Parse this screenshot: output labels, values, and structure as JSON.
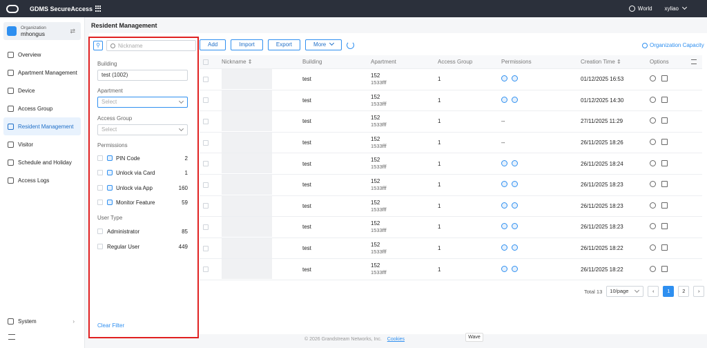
{
  "app": {
    "title": "GDMS SecureAccess"
  },
  "topbar": {
    "region": "World",
    "user": "xyliao"
  },
  "sidebar": {
    "org_label": "Organization",
    "org_name": "mhongus",
    "items": [
      {
        "label": "Overview",
        "icon": "overview-icon"
      },
      {
        "label": "Apartment Management",
        "icon": "building-icon"
      },
      {
        "label": "Device",
        "icon": "device-icon"
      },
      {
        "label": "Access Group",
        "icon": "access-group-icon"
      },
      {
        "label": "Resident Management",
        "icon": "resident-icon",
        "active": true
      },
      {
        "label": "Visitor",
        "icon": "visitor-icon"
      },
      {
        "label": "Schedule and Holiday",
        "icon": "calendar-icon"
      },
      {
        "label": "Access Logs",
        "icon": "logs-icon"
      }
    ],
    "system_label": "System"
  },
  "page": {
    "title": "Resident Management"
  },
  "filters": {
    "search_placeholder": "Nickname",
    "building_label": "Building",
    "building_value": "test (1002)",
    "apartment_label": "Apartment",
    "apartment_placeholder": "Select",
    "access_group_label": "Access Group",
    "access_group_placeholder": "Select",
    "permissions_label": "Permissions",
    "permissions": [
      {
        "label": "PIN Code",
        "count": "2"
      },
      {
        "label": "Unlock via Card",
        "count": "1"
      },
      {
        "label": "Unlock via App",
        "count": "160"
      },
      {
        "label": "Monitor Feature",
        "count": "59"
      }
    ],
    "user_type_label": "User Type",
    "user_types": [
      {
        "label": "Administrator",
        "count": "85"
      },
      {
        "label": "Regular User",
        "count": "449"
      }
    ],
    "clear_label": "Clear Filter"
  },
  "toolbar": {
    "add": "Add",
    "import": "Import",
    "export": "Export",
    "more": "More",
    "capacity": "Organization Capacity"
  },
  "table": {
    "headers": {
      "nickname": "Nickname",
      "building": "Building",
      "apartment": "Apartment",
      "access_group": "Access Group",
      "permissions": "Permissions",
      "creation_time": "Creation Time",
      "options": "Options"
    },
    "rows": [
      {
        "building": "test",
        "apt": "152",
        "apt2": "1533fff",
        "group": "1",
        "perms": "icons",
        "time": "01/12/2025 16:53"
      },
      {
        "building": "test",
        "apt": "152",
        "apt2": "1533fff",
        "group": "1",
        "perms": "icons",
        "time": "01/12/2025 14:30"
      },
      {
        "building": "test",
        "apt": "152",
        "apt2": "1533fff",
        "group": "1",
        "perms": "--",
        "time": "27/11/2025 11:29"
      },
      {
        "building": "test",
        "apt": "152",
        "apt2": "1533fff",
        "group": "1",
        "perms": "--",
        "time": "26/11/2025 18:26"
      },
      {
        "building": "test",
        "apt": "152",
        "apt2": "1533fff",
        "group": "1",
        "perms": "icons",
        "time": "26/11/2025 18:24"
      },
      {
        "building": "test",
        "apt": "152",
        "apt2": "1533fff",
        "group": "1",
        "perms": "icons",
        "time": "26/11/2025 18:23"
      },
      {
        "building": "test",
        "apt": "152",
        "apt2": "1533fff",
        "group": "1",
        "perms": "icons",
        "time": "26/11/2025 18:23"
      },
      {
        "building": "test",
        "apt": "152",
        "apt2": "1533fff",
        "group": "1",
        "perms": "icons",
        "time": "26/11/2025 18:23"
      },
      {
        "building": "test",
        "apt": "152",
        "apt2": "1533fff",
        "group": "1",
        "perms": "icons",
        "time": "26/11/2025 18:22"
      },
      {
        "building": "test",
        "apt": "152",
        "apt2": "1533fff",
        "group": "1",
        "perms": "icons",
        "time": "26/11/2025 18:22"
      }
    ]
  },
  "pagination": {
    "total": "Total 13",
    "page_size": "10/page",
    "pages": [
      "1",
      "2"
    ],
    "current": "1"
  },
  "footer": {
    "copyright": "© 2026 Grandstream Networks, Inc.",
    "cookies": "Cookies"
  },
  "tooltip": {
    "wave": "Wave"
  }
}
